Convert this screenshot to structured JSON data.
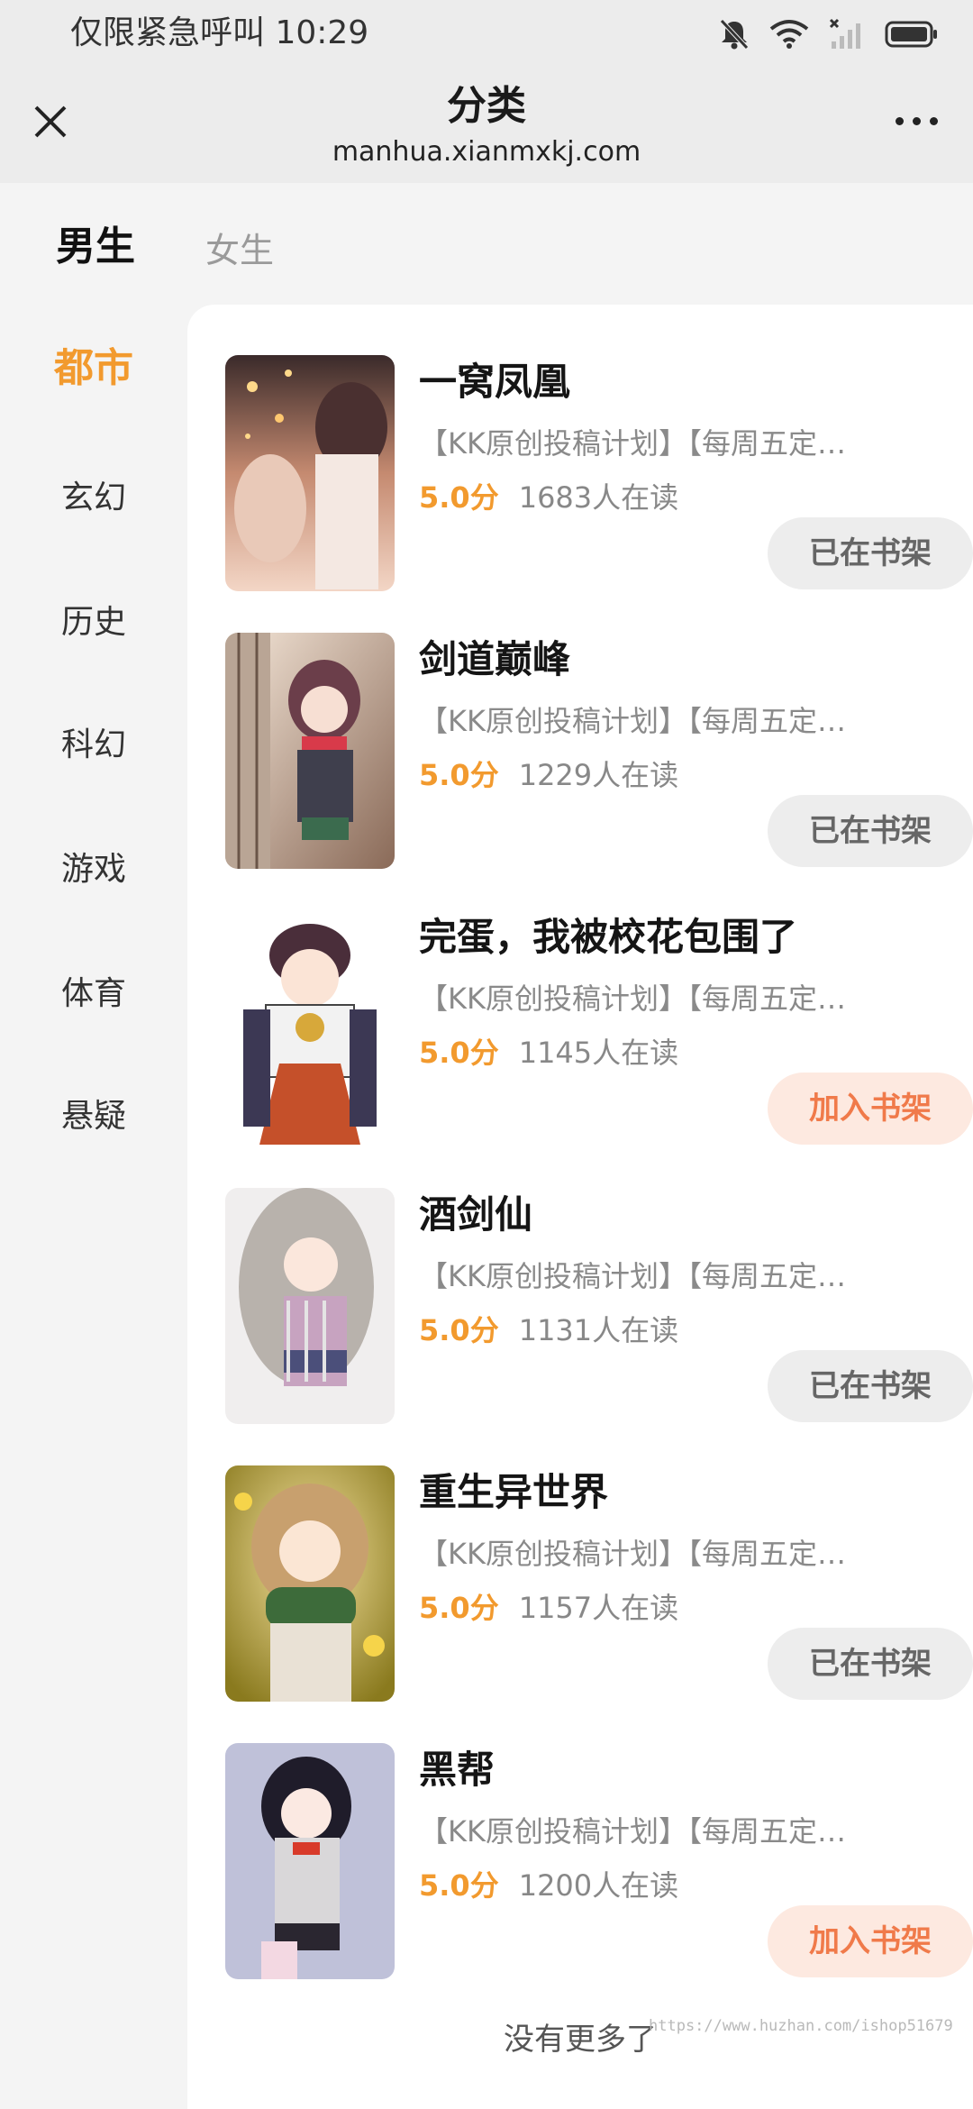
{
  "status_bar": {
    "left_text": "仅限紧急呼叫 10:29",
    "icons": [
      "bell-muted-icon",
      "wifi-icon",
      "signal-icon",
      "battery-icon"
    ]
  },
  "header": {
    "title": "分类",
    "url": "manhua.xianmxkj.com",
    "close_icon": "close-icon",
    "more_icon": "more-icon"
  },
  "gender_tabs": [
    {
      "label": "男生",
      "active": true
    },
    {
      "label": "女生",
      "active": false
    }
  ],
  "categories": [
    {
      "label": "都市",
      "active": true
    },
    {
      "label": "玄幻",
      "active": false
    },
    {
      "label": "历史",
      "active": false
    },
    {
      "label": "科幻",
      "active": false
    },
    {
      "label": "游戏",
      "active": false
    },
    {
      "label": "体育",
      "active": false
    },
    {
      "label": "悬疑",
      "active": false
    }
  ],
  "comics": [
    {
      "title": "一窝凤凰",
      "tags": "【KK原创投稿计划】【每周五定…",
      "score": "5.0分",
      "readers": "1683人在读",
      "shelf_label": "已在书架",
      "in_shelf": true
    },
    {
      "title": "剑道巅峰",
      "tags": "【KK原创投稿计划】【每周五定…",
      "score": "5.0分",
      "readers": "1229人在读",
      "shelf_label": "已在书架",
      "in_shelf": true
    },
    {
      "title": "完蛋，我被校花包围了",
      "tags": "【KK原创投稿计划】【每周五定…",
      "score": "5.0分",
      "readers": "1145人在读",
      "shelf_label": "加入书架",
      "in_shelf": false
    },
    {
      "title": "酒剑仙",
      "tags": "【KK原创投稿计划】【每周五定…",
      "score": "5.0分",
      "readers": "1131人在读",
      "shelf_label": "已在书架",
      "in_shelf": true
    },
    {
      "title": "重生异世界",
      "tags": "【KK原创投稿计划】【每周五定…",
      "score": "5.0分",
      "readers": "1157人在读",
      "shelf_label": "已在书架",
      "in_shelf": true
    },
    {
      "title": "黑帮",
      "tags": "【KK原创投稿计划】【每周五定…",
      "score": "5.0分",
      "readers": "1200人在读",
      "shelf_label": "加入书架",
      "in_shelf": false
    }
  ],
  "end_note": "没有更多了",
  "watermark": "https://www.huzhan.com/ishop51679",
  "colors": {
    "accent": "#f29a2e",
    "add_button_text": "#f07a4a",
    "add_button_bg": "#fde9e0",
    "in_shelf_bg": "#ededed"
  }
}
